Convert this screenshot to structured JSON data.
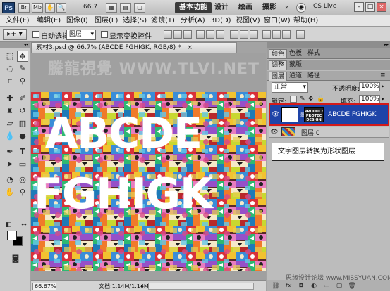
{
  "app": {
    "logo": "Ps",
    "zoom": "66.7",
    "workspaces": [
      "基本功能",
      "设计",
      "绘画",
      "摄影"
    ],
    "cs_live": "CS Live"
  },
  "menu": [
    "文件(F)",
    "编辑(E)",
    "图像(I)",
    "图层(L)",
    "选择(S)",
    "滤镜(T)",
    "分析(A)",
    "3D(D)",
    "视图(V)",
    "窗口(W)",
    "帮助(H)"
  ],
  "options": {
    "auto_select_label": "自动选择:",
    "auto_select_value": "图层",
    "show_transform_label": "显示变换控件"
  },
  "document": {
    "tab_title": "素材3.psd @ 66.7% (ABCDE FGHIGK, RGB/8) *",
    "close_glyph": "×",
    "watermark": "騰龍視覺 WWW.TLVI.NET",
    "line1": "ABCDE",
    "line2": "FGHIGK",
    "zoom_status": "66.67%",
    "doc_info": "文档:1.14M/1.14M"
  },
  "panels": {
    "top_tabs": [
      "颜色",
      "色板",
      "样式"
    ],
    "mid_tabs": [
      "调整",
      "蒙版"
    ],
    "layer_tabs": [
      "图层",
      "通道",
      "路径"
    ],
    "blend_mode": "正常",
    "opacity_label": "不透明度:",
    "opacity_value": "100%",
    "lock_label": "锁定:",
    "fill_label": "填充:",
    "fill_value": "100%",
    "layers": [
      {
        "name": "ABCDE FGHIGK",
        "thumb_text": "PRODUCE PROTEC DESIGN"
      },
      {
        "name": "图层 0"
      }
    ],
    "callout": "文字图层转换为形状图层"
  },
  "forum_watermark": "思缘设计论坛 www.MISSYUAN.COM",
  "colors": {
    "selected_layer": "#1e44a8",
    "highlight_border": "#d41a1a"
  }
}
